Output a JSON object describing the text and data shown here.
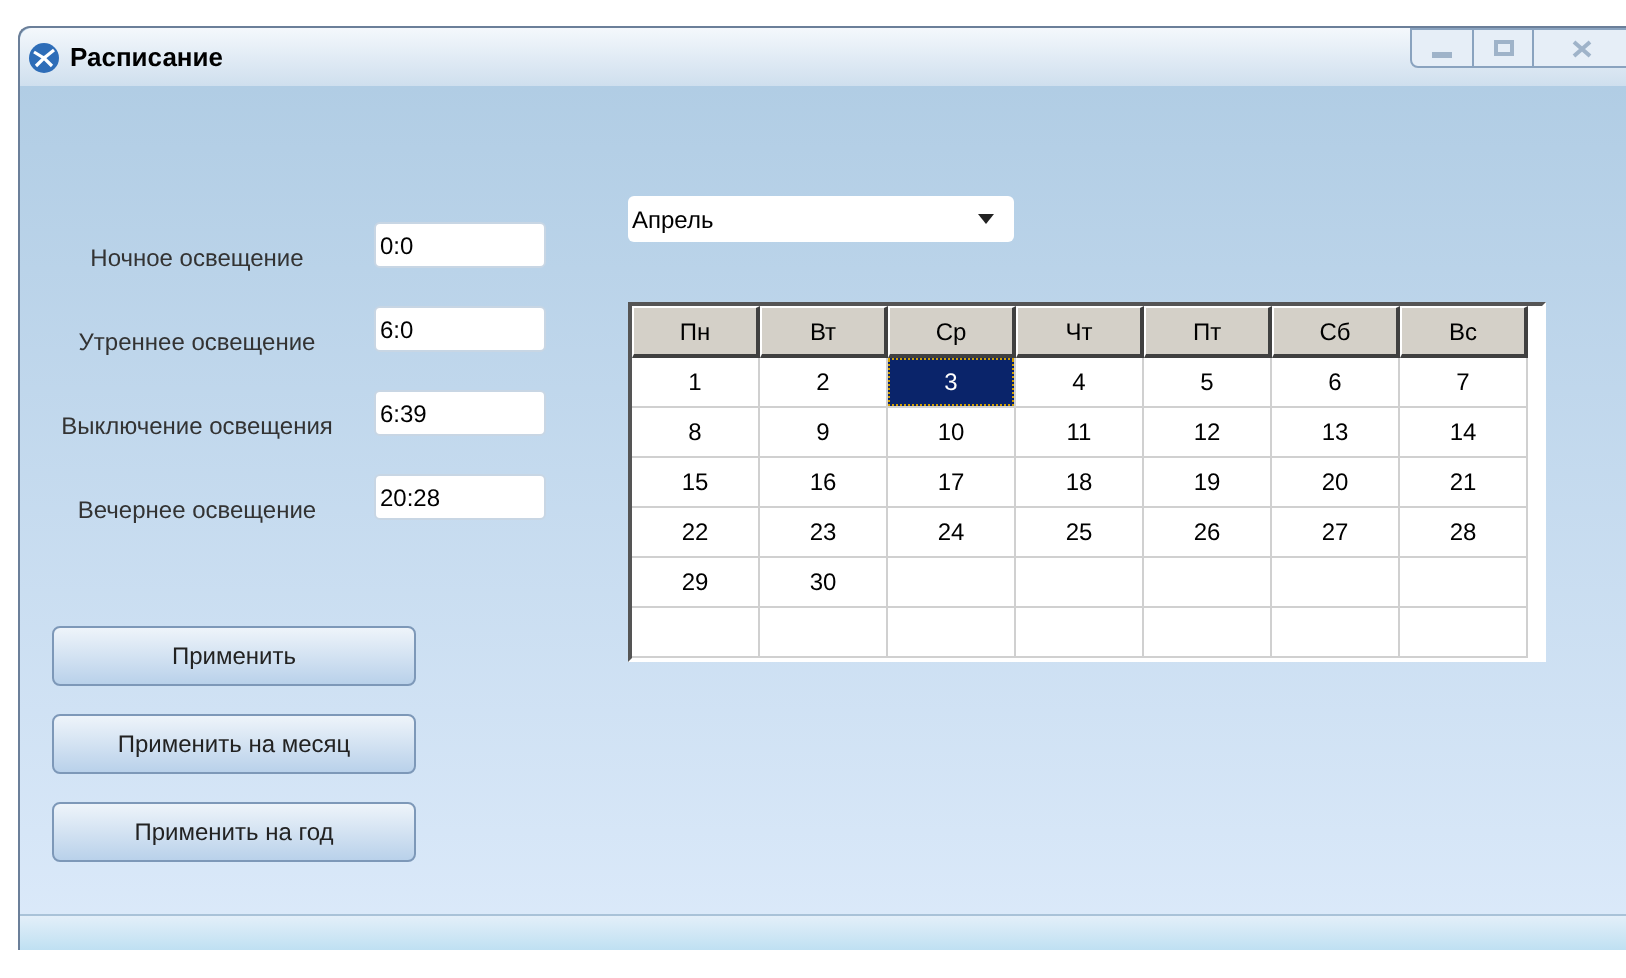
{
  "window": {
    "title": "Расписание"
  },
  "fields": [
    {
      "label": "Ночное освещение",
      "value": "0:0"
    },
    {
      "label": "Утреннее освещение",
      "value": "6:0"
    },
    {
      "label": "Выключение освещения",
      "value": "6:39"
    },
    {
      "label": "Вечернее освещение",
      "value": "20:28"
    }
  ],
  "buttons": [
    "Применить",
    "Применить на месяц",
    "Применить на год"
  ],
  "month_select": {
    "value": "Апрель"
  },
  "calendar": {
    "columns": [
      "Пн",
      "Вт",
      "Ср",
      "Чт",
      "Пт",
      "Сб",
      "Вс"
    ],
    "rows": [
      [
        {
          "day": "1",
          "selected": false
        },
        {
          "day": "2",
          "selected": false
        },
        {
          "day": "3",
          "selected": true
        },
        {
          "day": "4",
          "selected": false
        },
        {
          "day": "5",
          "selected": false
        },
        {
          "day": "6",
          "selected": false
        },
        {
          "day": "7",
          "selected": false
        }
      ],
      [
        {
          "day": "8",
          "selected": false
        },
        {
          "day": "9",
          "selected": false
        },
        {
          "day": "10",
          "selected": false
        },
        {
          "day": "11",
          "selected": false
        },
        {
          "day": "12",
          "selected": false
        },
        {
          "day": "13",
          "selected": false
        },
        {
          "day": "14",
          "selected": false
        }
      ],
      [
        {
          "day": "15",
          "selected": false
        },
        {
          "day": "16",
          "selected": false
        },
        {
          "day": "17",
          "selected": false
        },
        {
          "day": "18",
          "selected": false
        },
        {
          "day": "19",
          "selected": false
        },
        {
          "day": "20",
          "selected": false
        },
        {
          "day": "21",
          "selected": false
        }
      ],
      [
        {
          "day": "22",
          "selected": false
        },
        {
          "day": "23",
          "selected": false
        },
        {
          "day": "24",
          "selected": false
        },
        {
          "day": "25",
          "selected": false
        },
        {
          "day": "26",
          "selected": false
        },
        {
          "day": "27",
          "selected": false
        },
        {
          "day": "28",
          "selected": false
        }
      ],
      [
        {
          "day": "29",
          "selected": false
        },
        {
          "day": "30",
          "selected": false
        }
      ]
    ]
  }
}
